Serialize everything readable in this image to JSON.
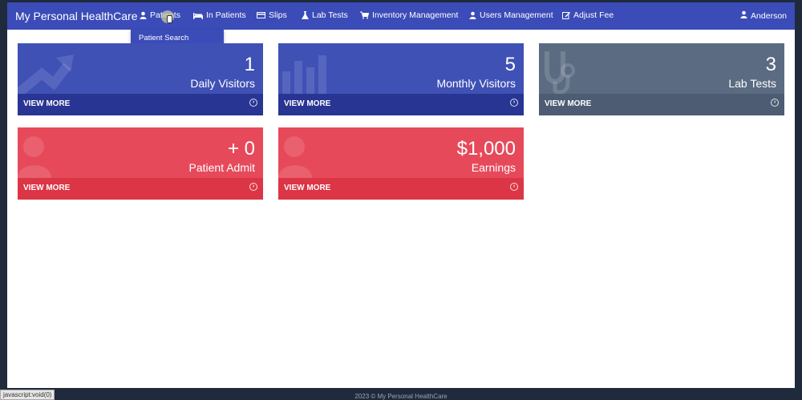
{
  "brand": "My Personal HealthCare",
  "nav": {
    "patients": "Patients",
    "in_patients": "In Patients",
    "slips": "Slips",
    "lab_tests": "Lab Tests",
    "inventory": "Inventory Management",
    "users": "Users Management",
    "adjust_fee": "Adjust Fee",
    "user": "Anderson"
  },
  "dropdown": {
    "patient_search": "Patient Search"
  },
  "cards": [
    {
      "value": "1",
      "label": "Daily Visitors",
      "link": "VIEW MORE",
      "color": "#3f51b5"
    },
    {
      "value": "5",
      "label": "Monthly Visitors",
      "link": "VIEW MORE",
      "color": "#3f51b5"
    },
    {
      "value": "3",
      "label": "Lab Tests",
      "link": "VIEW MORE",
      "color": "#5b6b82"
    },
    {
      "value": "+ 0",
      "label": "Patient Admit",
      "link": "VIEW MORE",
      "color": "#e64a5a"
    },
    {
      "value": "$1,000",
      "label": "Earnings",
      "link": "VIEW MORE",
      "color": "#e64a5a"
    }
  ],
  "status_bar": "javascript:void(0)",
  "footer": "2023 © My Personal HealthCare"
}
